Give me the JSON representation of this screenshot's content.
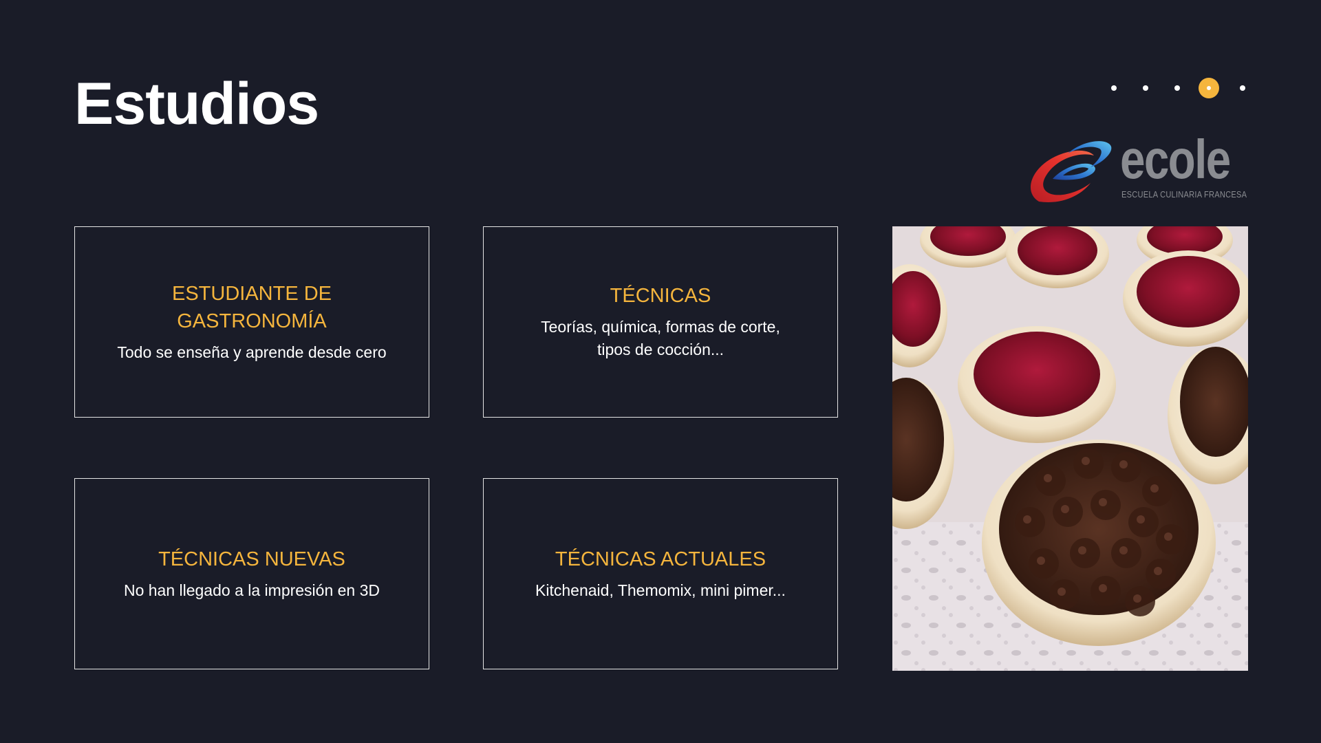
{
  "slide": {
    "title": "Estudios"
  },
  "pager": {
    "total": 5,
    "active_index": 3,
    "active_color": "#f5b53d"
  },
  "logo": {
    "word": "ecole",
    "tagline": "ESCUELA CULINARIA FRANCESA"
  },
  "cards": [
    {
      "title": "ESTUDIANTE DE GASTRONOMÍA",
      "text": "Todo se enseña y aprende desde cero"
    },
    {
      "title": "TÉCNICAS",
      "text": "Teorías, química, formas de corte, tipos de cocción..."
    },
    {
      "title": "TÉCNICAS NUEVAS",
      "text": "No han llegado a la impresión en 3D"
    },
    {
      "title": "TÉCNICAS ACTUALES",
      "text": "Kitchenaid, Themomix, mini pimer..."
    }
  ],
  "colors": {
    "background": "#1a1c28",
    "accent": "#f5b53d",
    "text": "#ffffff"
  },
  "image": {
    "icon": "dessert-photo"
  }
}
